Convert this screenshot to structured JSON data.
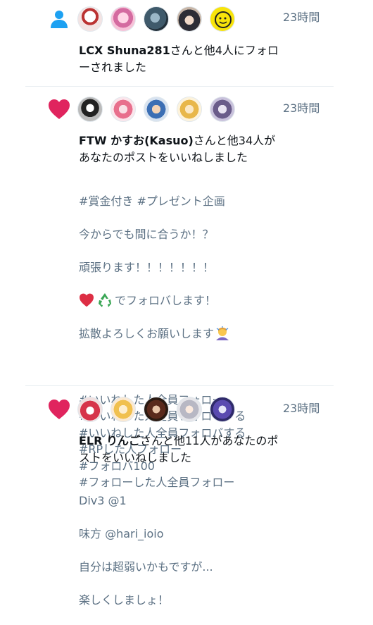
{
  "colors": {
    "accent_blue": "#1da1f2",
    "like_pink": "#e0245e",
    "secondary_text": "#5b7083",
    "divider": "#e6ecf0"
  },
  "notifications": [
    {
      "type_icon": "person-icon",
      "time": "23時間",
      "user": "LCX Shuna281",
      "action": "さんと他4人にフォローされました"
    },
    {
      "type_icon": "heart-icon",
      "time": "23時間",
      "user": "FTW かすお(Kasuo)",
      "action": "さんと他34人があなたのポストをいいねしました",
      "post": {
        "line1": "#賞金付き #プレゼント企画",
        "line2": "今からでも間に合うか！？",
        "line3": "頑張ります！！！！！！！",
        "line4": "でフォロバします！",
        "line5": "拡散よろしくお願いします",
        "tags": "#いいねした人全員フォロー\n#いいねした人全員フォローする\n#いいねした人全員フォロバする\n#RPした人フォロー\n#フォロバ100\n#フォローした人全員フォロー"
      }
    },
    {
      "type_icon": "heart-icon",
      "time": "23時間",
      "user": "ELR りんご",
      "action": "さんと他11人があなたのポストをいいねしました",
      "post": {
        "line1": "Div3 @1",
        "line2": "味方 @hari_ioio",
        "line3": "自分は超弱いかもですが...",
        "line4": "楽しくしましょ！"
      }
    }
  ]
}
